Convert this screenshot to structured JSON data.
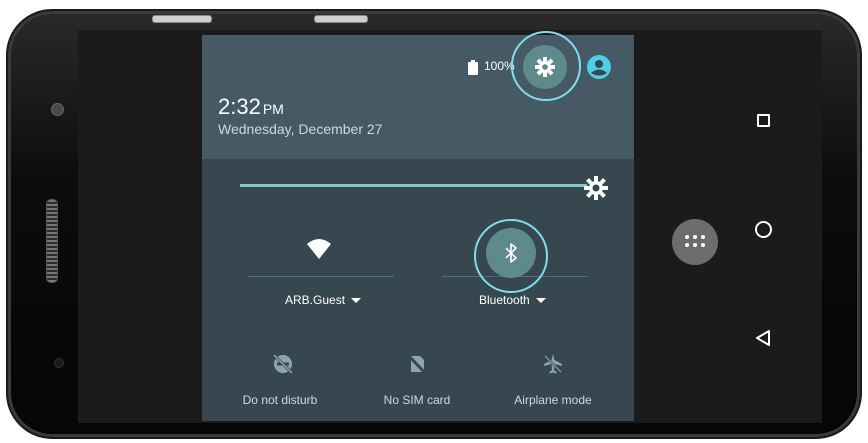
{
  "status_bar": {
    "battery_text": "100%"
  },
  "header": {
    "time": "2:32",
    "ampm": "PM",
    "date": "Wednesday, December 27"
  },
  "brightness": {
    "level": 1.0
  },
  "tiles": [
    {
      "label": "ARB.Guest",
      "icon": "wifi-icon"
    },
    {
      "label": "Bluetooth",
      "icon": "bluetooth-icon"
    }
  ],
  "quick_toggles": [
    {
      "label": "Do not disturb",
      "icon": "do-not-disturb-icon"
    },
    {
      "label": "No SIM card",
      "icon": "no-sim-icon"
    },
    {
      "label": "Airplane mode",
      "icon": "airplane-icon"
    }
  ],
  "colors": {
    "panel": "#37474f",
    "panel_header": "#455a64",
    "accent": "#80cbc4",
    "highlight": "#80deea"
  }
}
